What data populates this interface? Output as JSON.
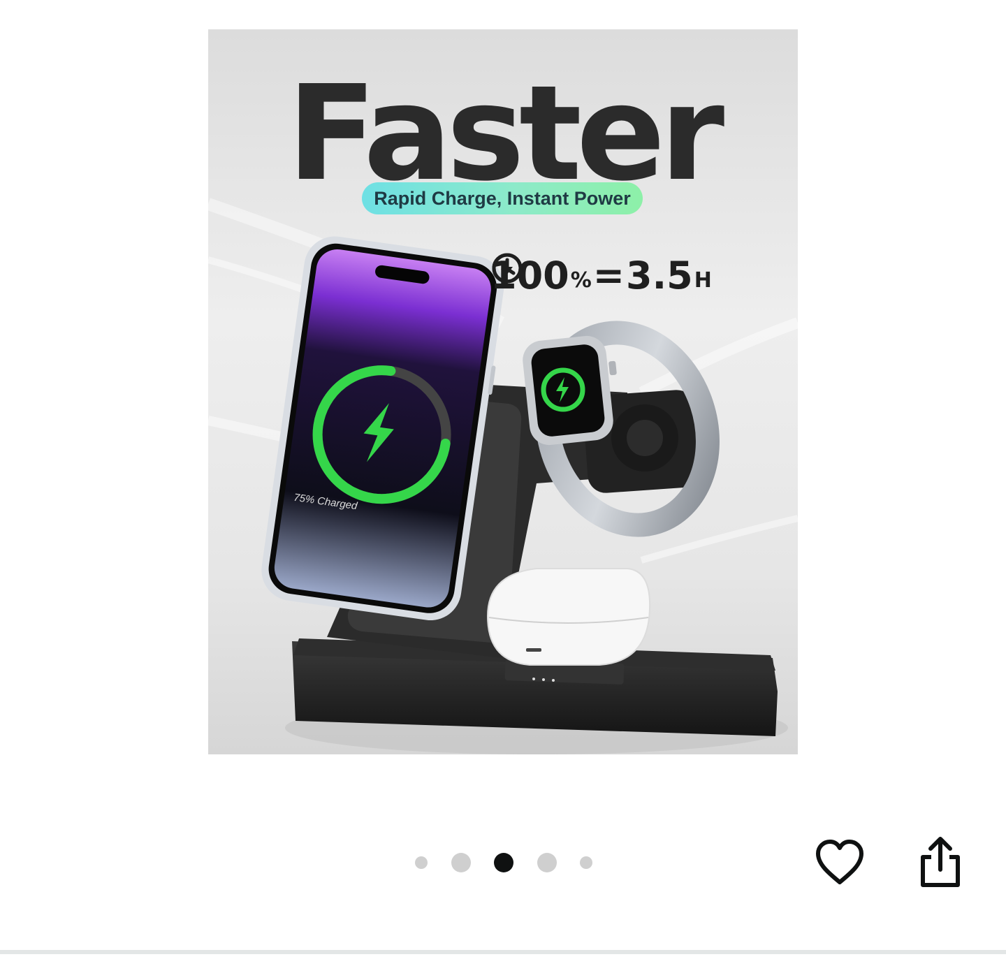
{
  "product_image": {
    "headline": "Faster",
    "tagline": "Rapid Charge, Instant Power",
    "spec": {
      "charge_value": "100",
      "percent_sign": "%",
      "equals": "=",
      "time_value": "3.5",
      "time_unit": "H"
    },
    "phone_screen_caption": "75% Charged",
    "phone_charge_fraction": 0.75,
    "accent_green": "#35d64a",
    "accent_purple": "#8a3fe0"
  },
  "carousel": {
    "total": 5,
    "active_index": 2
  },
  "actions": {
    "favorite_icon": "heart-outline-icon",
    "share_icon": "share-icon"
  }
}
